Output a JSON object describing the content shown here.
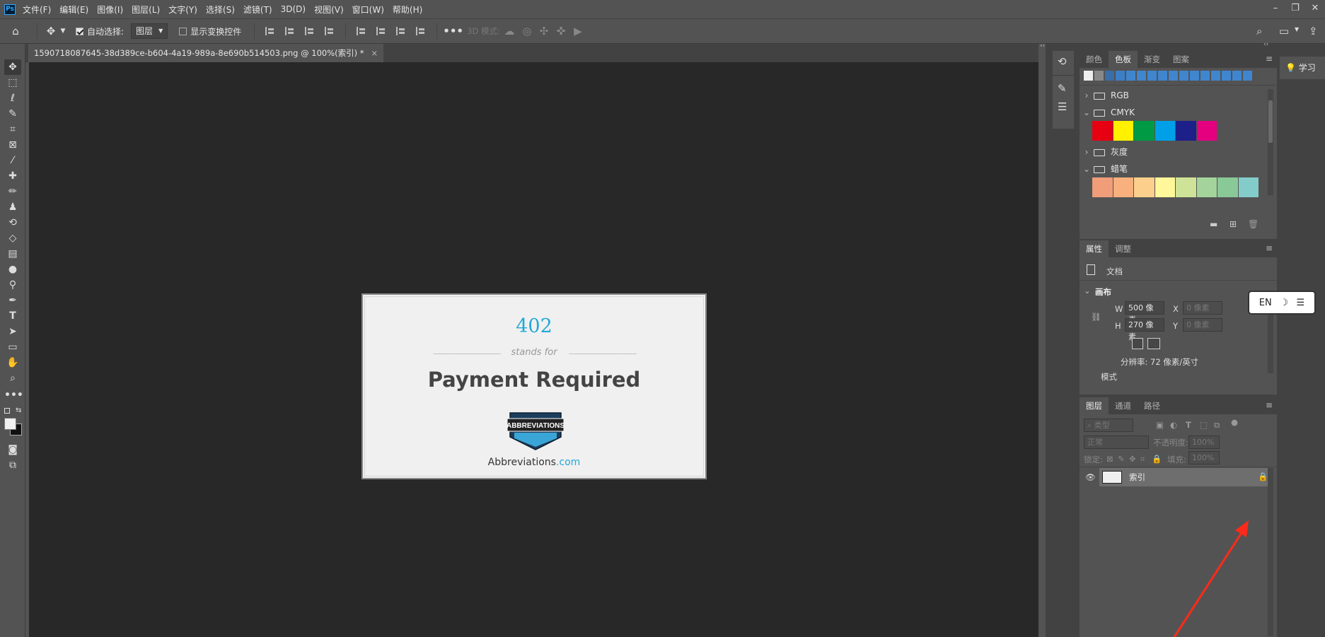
{
  "app": {
    "logo": "Ps"
  },
  "menu": [
    "文件(F)",
    "编辑(E)",
    "图像(I)",
    "图层(L)",
    "文字(Y)",
    "选择(S)",
    "滤镜(T)",
    "3D(D)",
    "视图(V)",
    "窗口(W)",
    "帮助(H)"
  ],
  "options": {
    "auto_select_label": "自动选择:",
    "auto_select_target": "图层",
    "show_transform_label": "显示变换控件",
    "mode_3d_label": "3D 模式:"
  },
  "document_tab": {
    "title": "1590718087645-38d389ce-b604-4a19-989a-8e690b514503.png @ 100%(索引) *",
    "close": "×"
  },
  "canvas_image": {
    "code": "402",
    "stands_for": "stands for",
    "title": "Payment Required",
    "logo_text": "ABBREVIATIONS",
    "site_name": "Abbreviations",
    "site_tld": ".com"
  },
  "swatches_panel": {
    "tabs": [
      "颜色",
      "色板",
      "渐变",
      "图案"
    ],
    "active_tab": "色板",
    "recent_colors": [
      "#eeeeee",
      "#888888",
      "#3a6ea8",
      "#3d7fc6",
      "#3f86cf",
      "#3f86cf",
      "#3f86cf",
      "#3f86cf",
      "#3f86cf",
      "#3f86cf",
      "#3f86cf",
      "#3f86cf",
      "#3f86cf",
      "#3f86cf",
      "#3f86cf",
      "#3f86cf"
    ],
    "groups": [
      {
        "name": "RGB",
        "expanded": false
      },
      {
        "name": "CMYK",
        "expanded": true,
        "colors": [
          "#e60012",
          "#fff100",
          "#009944",
          "#00a0e9",
          "#1d2088",
          "#e4007f"
        ]
      },
      {
        "name": "灰度",
        "expanded": false
      },
      {
        "name": "蜡笔",
        "expanded": true,
        "colors": [
          "#f19d7a",
          "#f7b07e",
          "#fcd08c",
          "#fff799",
          "#cfe398",
          "#a4d49c",
          "#89c997",
          "#84ccc9"
        ]
      }
    ]
  },
  "properties_panel": {
    "tabs": [
      "属性",
      "调整"
    ],
    "active_tab": "属性",
    "type_label": "文档",
    "section": "画布",
    "width_label": "W",
    "width_value": "500 像素",
    "height_label": "H",
    "height_value": "270 像素",
    "x_label": "X",
    "x_placeholder": "0 像素",
    "y_label": "Y",
    "y_placeholder": "0 像素",
    "resolution": "分辨率: 72 像素/英寸",
    "mode_label": "模式"
  },
  "layers_panel": {
    "tabs": [
      "图层",
      "通道",
      "路径"
    ],
    "active_tab": "图层",
    "filter_placeholder": "类型",
    "blend_mode": "正常",
    "opacity_label": "不透明度:",
    "opacity_value": "100%",
    "lock_label": "锁定:",
    "fill_label": "填充:",
    "fill_value": "100%",
    "layers": [
      {
        "name": "索引",
        "visible": true,
        "locked": true
      }
    ]
  },
  "learn": {
    "label": "学习"
  },
  "ime": {
    "lang": "EN"
  }
}
